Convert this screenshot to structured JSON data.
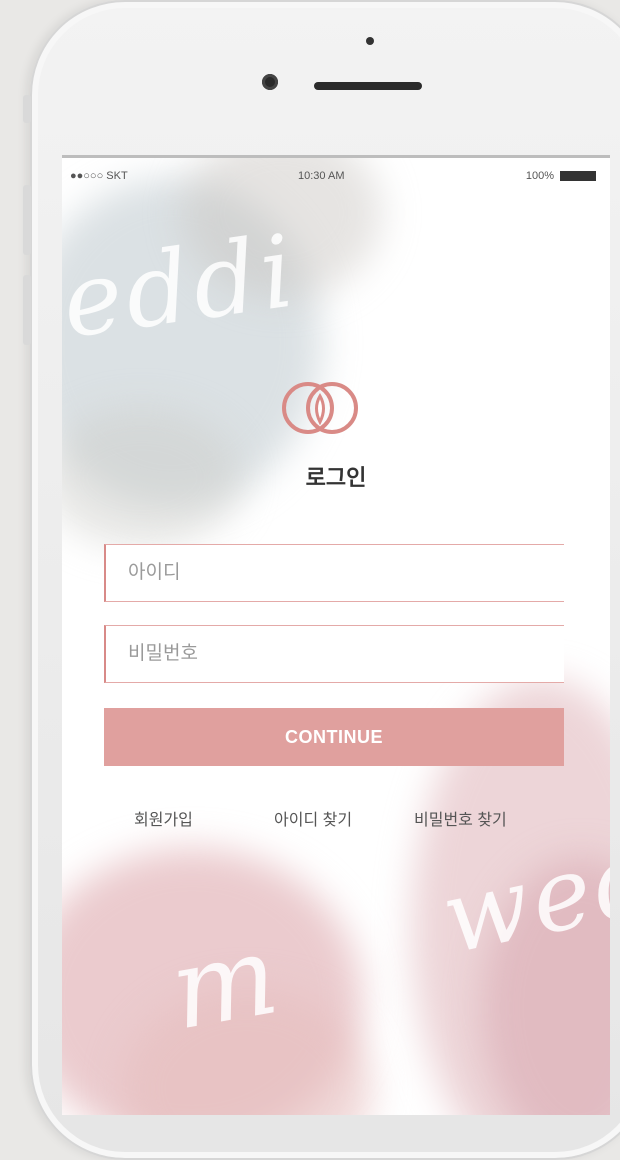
{
  "status_bar": {
    "carrier": "●●○○○ SKT",
    "time": "10:30 AM",
    "battery_percent": "100%"
  },
  "background": {
    "script_top": "eddi",
    "script_bottom_left": "m",
    "script_bottom_right": "wed"
  },
  "login": {
    "title": "로그인",
    "id_placeholder": "아이디",
    "password_placeholder": "비밀번호",
    "continue_label": "CONTINUE"
  },
  "links": {
    "signup": "회원가입",
    "find_id": "아이디 찾기",
    "find_password": "비밀번호 찾기"
  },
  "colors": {
    "accent": "#e0a09e",
    "field_border": "#e4aaa8",
    "logo": "#d98a86"
  },
  "icons": {
    "logo": "interlocking-rings-logo-icon",
    "battery": "battery-icon"
  }
}
